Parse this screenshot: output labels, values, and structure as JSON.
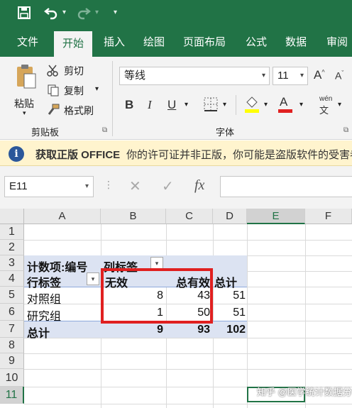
{
  "qat": {
    "save_icon": "save-icon",
    "undo_icon": "undo-icon",
    "redo_icon": "redo-icon"
  },
  "tabs": [
    {
      "label": "文件"
    },
    {
      "label": "开始"
    },
    {
      "label": "插入"
    },
    {
      "label": "绘图"
    },
    {
      "label": "页面布局"
    },
    {
      "label": "公式"
    },
    {
      "label": "数据"
    },
    {
      "label": "审阅"
    }
  ],
  "ribbon": {
    "paste_label": "粘贴",
    "cut_label": "剪切",
    "copy_label": "复制",
    "format_painter_label": "格式刷",
    "clipboard_group": "剪贴板",
    "font_name": "等线",
    "font_size": "11",
    "font_group": "字体",
    "bold": "B",
    "italic": "I",
    "underline": "U",
    "increase_font": "A",
    "decrease_font": "A",
    "font_color": "A",
    "phonetic": "wén"
  },
  "infobar": {
    "title": "获取正版 OFFICE",
    "message": "你的许可证并非正版，你可能是盗版软件的受害者"
  },
  "formula_bar": {
    "name_box": "E11",
    "fx": "fx",
    "formula": ""
  },
  "columns": [
    "A",
    "B",
    "C",
    "D",
    "E",
    "F"
  ],
  "rows": [
    "1",
    "2",
    "3",
    "4",
    "5",
    "6",
    "7",
    "8",
    "9",
    "10",
    "11"
  ],
  "cells": {
    "a3": "计数项:编号",
    "b3": "列标签",
    "a4": "行标签",
    "b4": "无效",
    "c4": "总有效",
    "d4": "总计",
    "a5": "对照组",
    "b5": "8",
    "c5": "43",
    "d5": "51",
    "a6": "研究组",
    "b6": "1",
    "c6": "50",
    "d6": "51",
    "a7": "总计",
    "b7": "9",
    "c7": "93",
    "d7": "102"
  },
  "watermark": "知乎 @医学统计数据分析",
  "colors": {
    "accent": "#217346",
    "pivot_band": "#dce3f2",
    "highlight_box": "#e02020"
  }
}
